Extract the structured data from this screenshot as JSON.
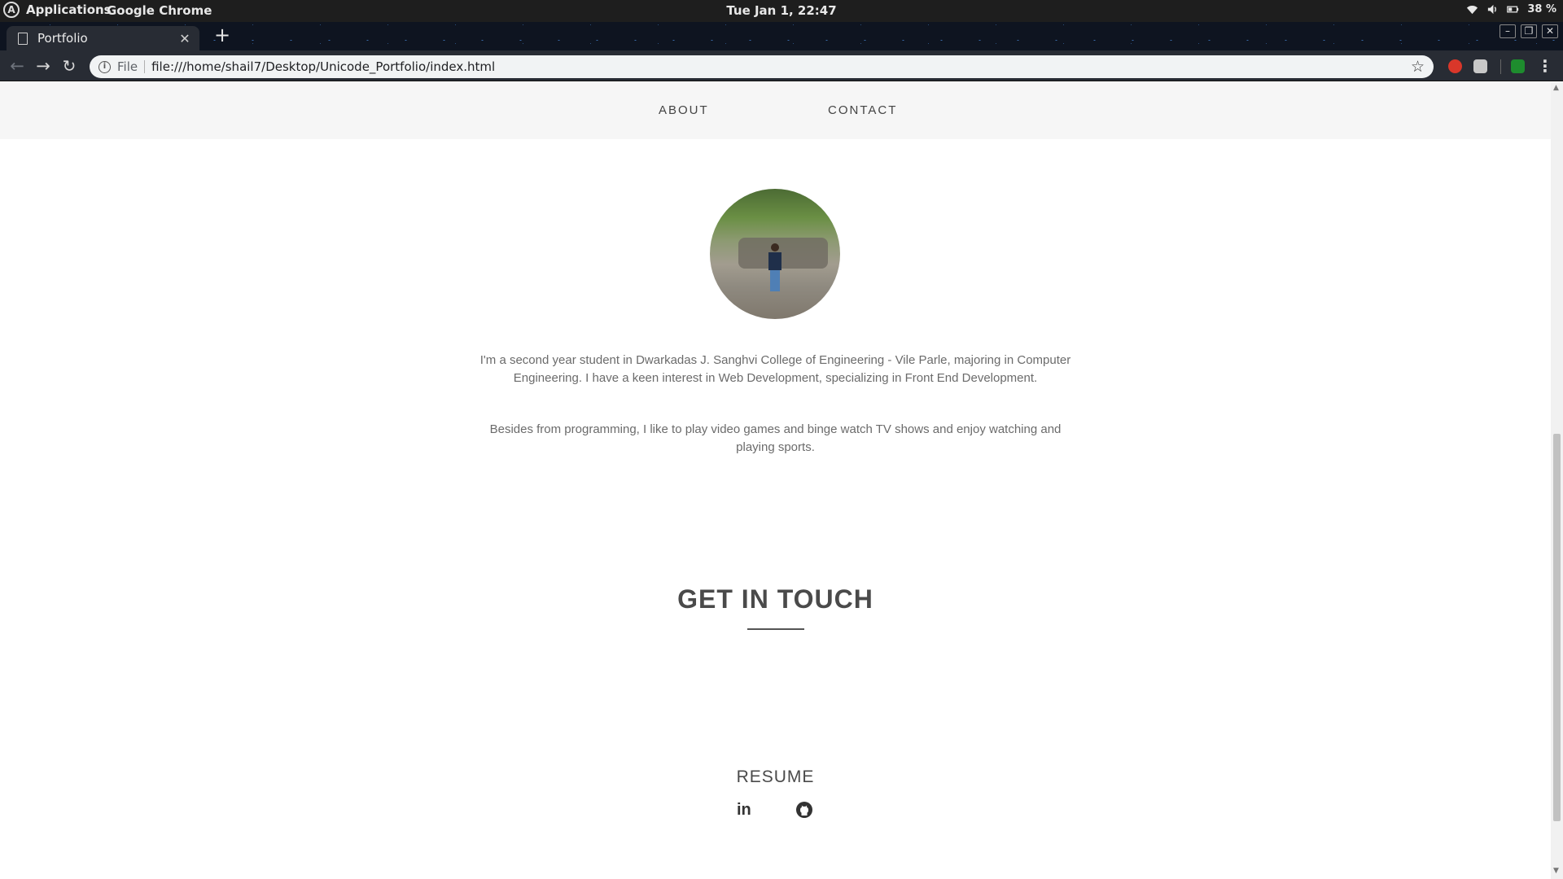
{
  "os": {
    "applications_label": "Applications",
    "active_app": "Google Chrome",
    "clock": "Tue Jan  1, 22:47",
    "battery": "38 %"
  },
  "browser": {
    "tab_title": "Portfolio",
    "scheme_label": "File",
    "url": "file:///home/shail7/Desktop/Unicode_Portfolio/index.html"
  },
  "page": {
    "nav": {
      "about": "ABOUT",
      "contact": "CONTACT"
    },
    "about_para_1": "I'm a second year student in Dwarkadas J. Sanghvi College of Engineering - Vile Parle, majoring in Computer Engineering. I have a keen interest in Web Development, specializing in Front End Development.",
    "about_para_2": "Besides from programming, I like to play video games and binge watch TV shows and enjoy watching and playing sports.",
    "contact_heading": "GET IN TOUCH",
    "resume_label": "RESUME",
    "linkedin_glyph": "in"
  },
  "icons": {
    "os_logo": "arch-logo-icon",
    "wifi": "wifi-icon",
    "volume": "volume-icon",
    "battery": "battery-icon",
    "tab_page": "document-icon",
    "tab_close": "close-icon",
    "new_tab": "plus-icon",
    "back": "arrow-left-icon",
    "forward": "arrow-right-icon",
    "reload": "reload-icon",
    "site_info": "info-icon",
    "bookmark": "star-icon",
    "menu": "kebab-menu-icon",
    "linkedin": "linkedin-icon",
    "github": "github-icon"
  }
}
